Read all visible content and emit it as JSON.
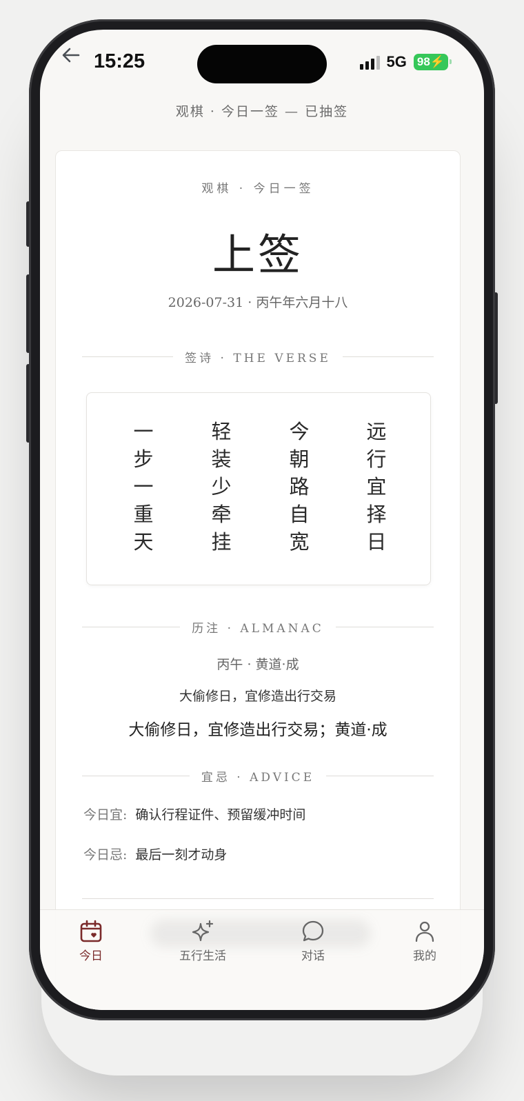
{
  "status_bar": {
    "time": "15:25",
    "network": "5G",
    "battery": "98"
  },
  "header": {
    "title": "观棋 · 今日一签 — 已抽签"
  },
  "card": {
    "subtitle": "观棋 · 今日一签",
    "title": "上签",
    "date": "2026-07-31 · 丙午年六月十八",
    "verse_section_label": "签诗 · THE VERSE",
    "verse_columns": [
      [
        "一",
        "步",
        "一",
        "重",
        "天"
      ],
      [
        "轻",
        "装",
        "少",
        "牵",
        "挂"
      ],
      [
        "今",
        "朝",
        "路",
        "自",
        "宽"
      ],
      [
        "远",
        "行",
        "宜",
        "择",
        "日"
      ]
    ],
    "almanac_section_label": "历注 · ALMANAC",
    "almanac_line1": "丙午 · 黄道·成",
    "almanac_line2": "大偷修日，宜修造出行交易",
    "almanac_line3": "大偷修日，宜修造出行交易；黄道·成",
    "advice_section_label": "宜忌 · ADVICE",
    "advice_yi_key": "今日宜:",
    "advice_yi_value": "确认行程证件、预留缓冲时间",
    "advice_ji_key": "今日忌:",
    "advice_ji_value": "最后一刻才动身"
  },
  "tabs": [
    {
      "label": "今日",
      "icon": "calendar-heart-icon",
      "active": true
    },
    {
      "label": "五行生活",
      "icon": "sparkles-icon",
      "active": false
    },
    {
      "label": "对话",
      "icon": "chat-bubble-icon",
      "active": false
    },
    {
      "label": "我的",
      "icon": "user-icon",
      "active": false
    }
  ],
  "colors": {
    "accent": "#7a2a2a",
    "battery": "#36c759"
  }
}
